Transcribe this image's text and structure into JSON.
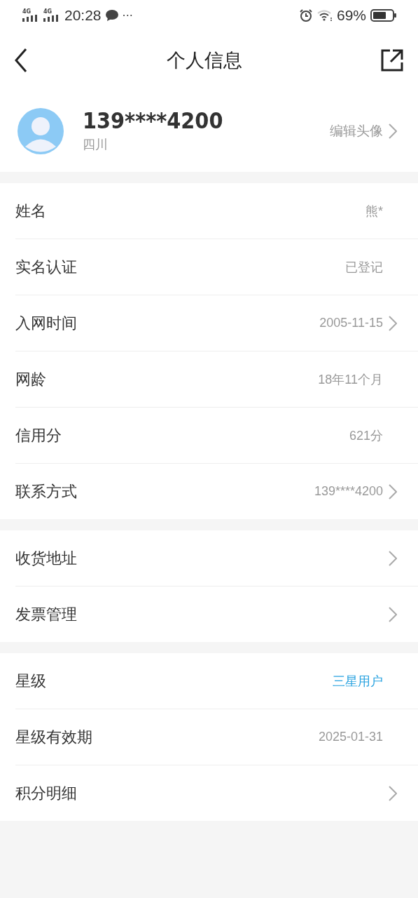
{
  "status_bar": {
    "network_1": "4G",
    "network_2": "4G",
    "time": "20:28",
    "more": "···",
    "battery": "69%"
  },
  "header": {
    "title": "个人信息"
  },
  "profile": {
    "phone": "139****4200",
    "region": "四川",
    "edit_label": "编辑头像"
  },
  "sections": [
    {
      "rows": [
        {
          "label": "姓名",
          "value": "熊*",
          "chevron": false,
          "highlight": false
        },
        {
          "label": "实名认证",
          "value": "已登记",
          "chevron": false,
          "highlight": false
        },
        {
          "label": "入网时间",
          "value": "2005-11-15",
          "chevron": true,
          "highlight": false
        },
        {
          "label": "网龄",
          "value": "18年11个月",
          "chevron": false,
          "highlight": false
        },
        {
          "label": "信用分",
          "value": "621分",
          "chevron": false,
          "highlight": false
        },
        {
          "label": "联系方式",
          "value": "139****4200",
          "chevron": true,
          "highlight": false
        }
      ]
    },
    {
      "rows": [
        {
          "label": "收货地址",
          "chevron": true
        },
        {
          "label": "发票管理",
          "chevron": true
        }
      ]
    },
    {
      "rows": [
        {
          "label": "星级",
          "value": "三星用户",
          "chevron": false,
          "highlight": true
        },
        {
          "label": "星级有效期",
          "value": "2025-01-31",
          "chevron": false,
          "highlight": false
        },
        {
          "label": "积分明细",
          "chevron": true
        }
      ]
    }
  ]
}
